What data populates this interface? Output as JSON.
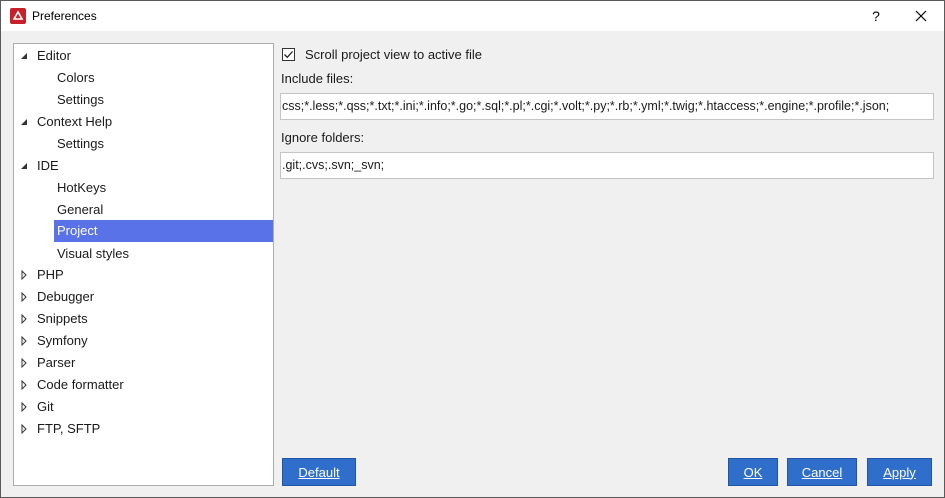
{
  "window": {
    "title": "Preferences",
    "help_label": "?",
    "close_label": "✕"
  },
  "tree": {
    "items": [
      {
        "label": "Editor",
        "expanded": true
      },
      {
        "label": "Colors"
      },
      {
        "label": "Settings"
      },
      {
        "label": "Context Help",
        "expanded": true
      },
      {
        "label": "Settings"
      },
      {
        "label": "IDE",
        "expanded": true
      },
      {
        "label": "HotKeys"
      },
      {
        "label": "General"
      },
      {
        "label": "Project",
        "selected": true
      },
      {
        "label": "Visual styles"
      },
      {
        "label": "PHP",
        "expanded": false
      },
      {
        "label": "Debugger",
        "expanded": false
      },
      {
        "label": "Snippets",
        "expanded": false
      },
      {
        "label": "Symfony",
        "expanded": false
      },
      {
        "label": "Parser",
        "expanded": false
      },
      {
        "label": "Code formatter",
        "expanded": false
      },
      {
        "label": "Git",
        "expanded": false
      },
      {
        "label": "FTP, SFTP",
        "expanded": false
      }
    ]
  },
  "project": {
    "scroll_label": "Scroll project view to active file",
    "scroll_checked": true,
    "include_label": "Include files:",
    "include_value": "css;*.less;*.qss;*.txt;*.ini;*.info;*.go;*.sql;*.pl;*.cgi;*.volt;*.py;*.rb;*.yml;*.twig;*.htaccess;*.engine;*.profile;*.json;",
    "ignore_label": "Ignore folders:",
    "ignore_value": ".git;.cvs;.svn;_svn;"
  },
  "buttons": {
    "default_label": "Default",
    "ok_label": "OK",
    "cancel_label": "Cancel",
    "apply_label": "Apply"
  },
  "colors": {
    "selection": "#5a72e8",
    "button": "#2f6fcb"
  }
}
